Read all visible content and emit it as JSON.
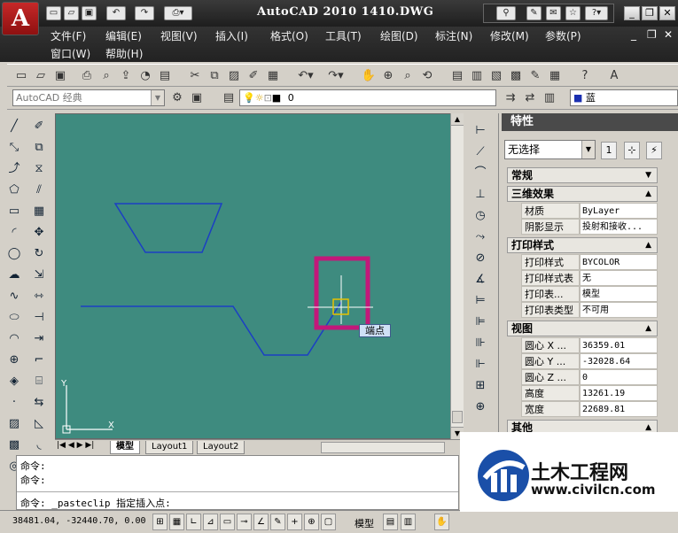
{
  "app": {
    "logo": "A",
    "title": "AutoCAD 2010  1410.DWG"
  },
  "menus": {
    "row1": [
      "文件(F)",
      "编辑(E)",
      "视图(V)",
      "插入(I)",
      "格式(O)",
      "工具(T)",
      "绘图(D)",
      "标注(N)",
      "修改(M)",
      "参数(P)"
    ],
    "row2": [
      "窗口(W)",
      "帮助(H)"
    ]
  },
  "toolbar": {
    "workspace": "AutoCAD 经典",
    "layer": "0",
    "color": "蓝"
  },
  "canvas": {
    "tooltip": "端点",
    "ucs_x": "X",
    "ucs_y": "Y"
  },
  "tabs": [
    "模型",
    "Layout1",
    "Layout2"
  ],
  "command": {
    "lines": [
      "命令:",
      "命令:"
    ],
    "prompt": "命令:  _pasteclip 指定插入点:"
  },
  "status": {
    "coords": "38481.04, -32440.70, 0.00",
    "model": "模型"
  },
  "properties": {
    "title": "特性",
    "selection": "无选择",
    "sections": {
      "general": "常规",
      "3d": "三维效果",
      "plot": "打印样式",
      "view": "视图",
      "misc": "其他"
    },
    "rows_3d": [
      {
        "k": "材质",
        "v": "ByLayer"
      },
      {
        "k": "阴影显示",
        "v": "投射和接收..."
      }
    ],
    "rows_plot": [
      {
        "k": "打印样式",
        "v": "BYCOLOR"
      },
      {
        "k": "打印样式表",
        "v": "无"
      },
      {
        "k": "打印表...",
        "v": "模型"
      },
      {
        "k": "打印表类型",
        "v": "不可用"
      }
    ],
    "rows_view": [
      {
        "k": "圆心 X ...",
        "v": "36359.01"
      },
      {
        "k": "圆心 Y ...",
        "v": "-32028.64"
      },
      {
        "k": "圆心 Z ...",
        "v": "0"
      },
      {
        "k": "高度",
        "v": "13261.19"
      },
      {
        "k": "宽度",
        "v": "22689.81"
      }
    ]
  },
  "watermark": {
    "brand": "土木工程网",
    "url": "www.civilcn.com"
  }
}
